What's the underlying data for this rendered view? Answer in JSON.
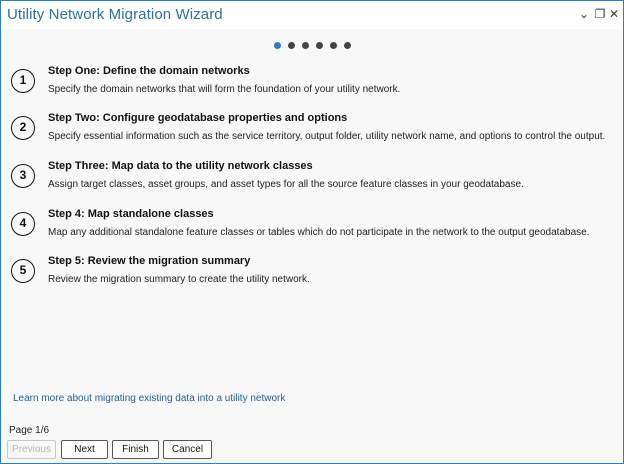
{
  "window": {
    "title": "Utility Network Migration Wizard",
    "controls": {
      "dropdown_icon": "chevron-down-icon",
      "restore_icon": "restore-icon",
      "close_icon": "close-icon",
      "dropdown_glyph": "⌄",
      "restore_glyph": "❐",
      "close_glyph": "✕"
    }
  },
  "pagination": {
    "total_dots": 6,
    "active_index": 0,
    "active_color": "#2b7bc6",
    "inactive_color": "#444444"
  },
  "steps": [
    {
      "number": "1",
      "title": "Step One: Define the domain networks",
      "description": "Specify the domain networks that will form the foundation of your utility network."
    },
    {
      "number": "2",
      "title": "Step Two: Configure geodatabase properties and options",
      "description": "Specify essential information such as the service territory, output folder, utility network name, and options to control the output."
    },
    {
      "number": "3",
      "title": "Step Three: Map data to the utility network classes",
      "description": "Assign target classes, asset groups, and asset types for all the source feature classes in your geodatabase."
    },
    {
      "number": "4",
      "title": "Step 4: Map standalone classes",
      "description": "Map any additional standalone feature classes or tables which do not participate in the network to the output geodatabase."
    },
    {
      "number": "5",
      "title": "Step 5: Review the migration summary",
      "description": "Review the migration summary to create the utility network."
    }
  ],
  "learn_more_link": "Learn more about migrating existing data into a utility network",
  "page_label": "Page 1/6",
  "buttons": {
    "previous": "Previous",
    "next": "Next",
    "finish": "Finish",
    "cancel": "Cancel"
  },
  "colors": {
    "border": "#2f7fc1",
    "title": "#2f6f9f",
    "link": "#1f5f92"
  }
}
